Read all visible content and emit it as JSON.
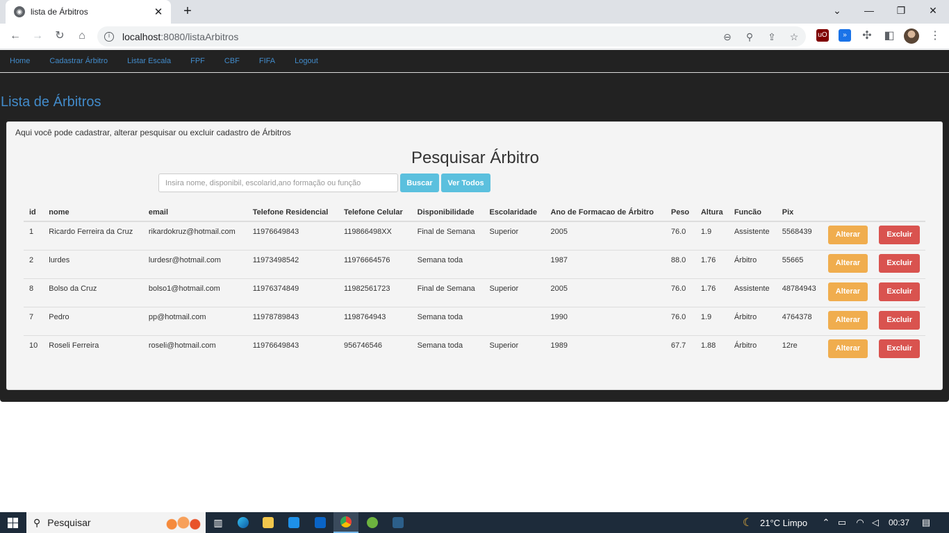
{
  "browser": {
    "tab_title": "lista de Árbitros",
    "url_host": "localhost",
    "url_rest": ":8080/listaArbitros",
    "icons": [
      "back-icon",
      "forward-icon",
      "reload-icon",
      "home-icon",
      "zoom-icon",
      "location-icon",
      "share-icon",
      "star-icon",
      "ublock-icon",
      "extension-icon",
      "puzzle-icon",
      "sidepanel-icon",
      "menu-icon"
    ]
  },
  "nav": {
    "items": [
      "Home",
      "Cadastrar Árbitro",
      "Listar Escala",
      "FPF",
      "CBF",
      "FIFA",
      "Logout"
    ]
  },
  "page": {
    "title": "Lista de Árbitros",
    "description": "Aqui você pode cadastrar, alterar pesquisar ou excluir cadastro de Árbitros",
    "search_title": "Pesquisar Árbitro",
    "search_placeholder": "Insira nome, disponibil, escolarid,ano formação ou função",
    "search_button": "Buscar",
    "all_button": "Ver Todos"
  },
  "table": {
    "headers": [
      "id",
      "nome",
      "email",
      "Telefone Residencial",
      "Telefone Celular",
      "Disponibilidade",
      "Escolaridade",
      "Ano de Formacao de Árbitro",
      "Peso",
      "Altura",
      "Funcão",
      "Pix"
    ],
    "rows": [
      [
        "1",
        "Ricardo Ferreira da Cruz",
        "rikardokruz@hotmail.com",
        "11976649843",
        "119866498XX",
        "Final de Semana",
        "Superior",
        "2005",
        "76.0",
        "1.9",
        "Assistente",
        "5568439"
      ],
      [
        "2",
        "lurdes",
        "lurdesr@hotmail.com",
        "11973498542",
        "11976664576",
        "Semana toda",
        "",
        "1987",
        "88.0",
        "1.76",
        "Árbitro",
        "55665"
      ],
      [
        "8",
        "Bolso da Cruz",
        "bolso1@hotmail.com",
        "11976374849",
        "11982561723",
        "Final de Semana",
        "Superior",
        "2005",
        "76.0",
        "1.76",
        "Assistente",
        "48784943"
      ],
      [
        "7",
        "Pedro",
        "pp@hotmail.com",
        "11978789843",
        "1198764943",
        "Semana toda",
        "",
        "1990",
        "76.0",
        "1.9",
        "Árbitro",
        "4764378"
      ],
      [
        "10",
        "Roseli Ferreira",
        "roseli@hotmail.com",
        "11976649843",
        "956746546",
        "Semana toda",
        "Superior",
        "1989",
        "67.7",
        "1.88",
        "Árbitro",
        "12re"
      ]
    ],
    "edit_label": "Alterar",
    "delete_label": "Excluir"
  },
  "taskbar": {
    "search_label": "Pesquisar",
    "weather": "21°C  Limpo",
    "time": "00:37"
  },
  "colors": {
    "link": "#428bca",
    "info": "#5bc0de",
    "warning": "#f0ad4e",
    "danger": "#d9534f",
    "dark_bg": "#222222"
  }
}
